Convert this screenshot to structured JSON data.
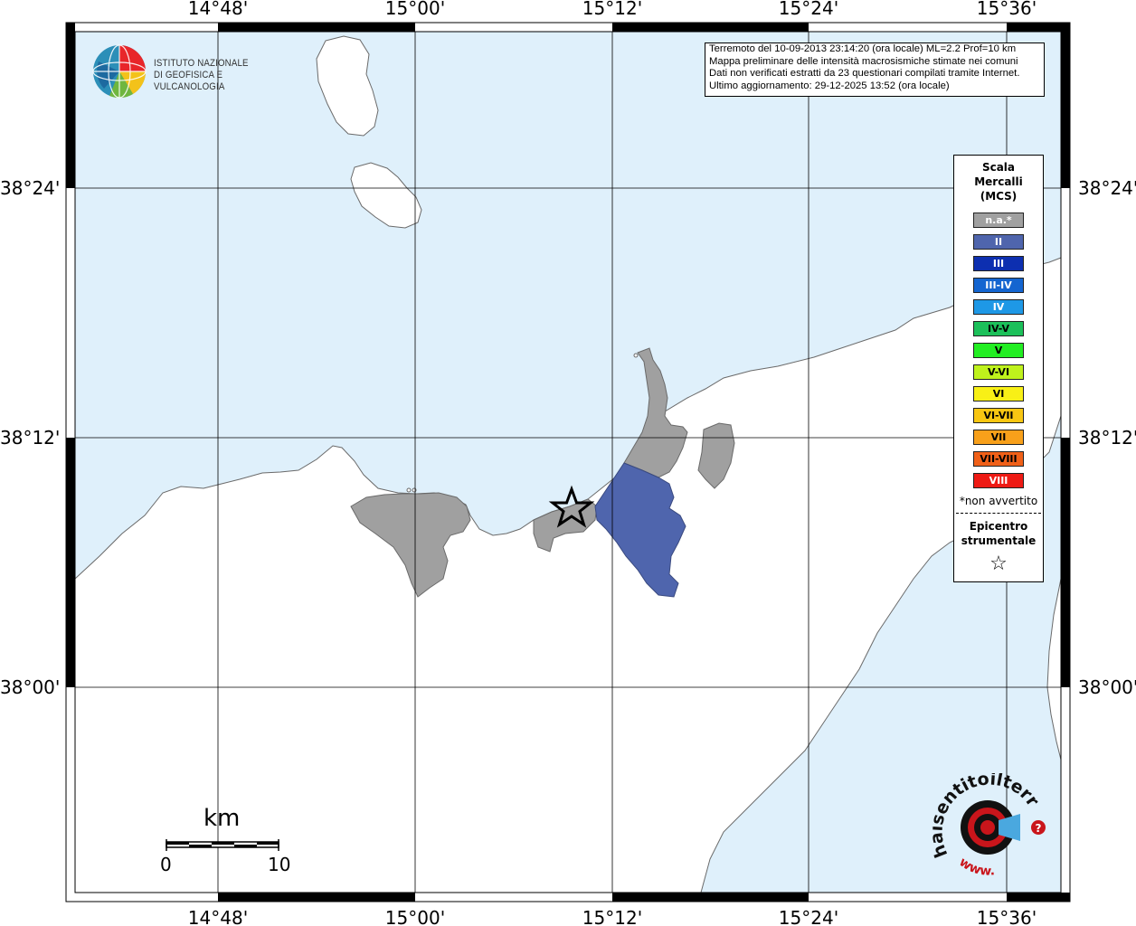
{
  "ticks": {
    "top": [
      "14°48'",
      "15°00'",
      "15°12'",
      "15°24'",
      "15°36'"
    ],
    "bottom": [
      "14°48'",
      "15°00'",
      "15°12'",
      "15°24'",
      "15°36'"
    ],
    "left": [
      "38°24'",
      "38°12'",
      "38°00'"
    ],
    "right": [
      "38°24'",
      "38°12'",
      "38°00'"
    ]
  },
  "info": {
    "line1": "Terremoto del 10-09-2013 23:14:20 (ora locale) ML=2.2 Prof=10 km",
    "line2": "Mappa preliminare delle intensità macrosismiche stimate nei comuni",
    "line3": "Dati non verificati estratti da 23 questionari compilati tramite Internet.",
    "line4": "Ultimo aggiornamento: 29-12-2025 13:52 (ora locale)"
  },
  "logo": {
    "line1": "ISTITUTO NAZIONALE",
    "line2": "DI GEOFISICA E VULCANOLOGIA"
  },
  "legend": {
    "title1": "Scala",
    "title2": "Mercalli",
    "title3": "(MCS)",
    "items": [
      {
        "label": "n.a.*",
        "color": "#a0a0a0",
        "text": "#ffffff"
      },
      {
        "label": "II",
        "color": "#4f65ad",
        "text": "#ffffff"
      },
      {
        "label": "III",
        "color": "#0d2fb0",
        "text": "#ffffff"
      },
      {
        "label": "III-IV",
        "color": "#1465d0",
        "text": "#ffffff"
      },
      {
        "label": "IV",
        "color": "#1e98e6",
        "text": "#ffffff"
      },
      {
        "label": "IV-V",
        "color": "#1cc05a",
        "text": "#000000"
      },
      {
        "label": "V",
        "color": "#22ee22",
        "text": "#000000"
      },
      {
        "label": "V-VI",
        "color": "#bff21c",
        "text": "#000000"
      },
      {
        "label": "VI",
        "color": "#f8f016",
        "text": "#000000"
      },
      {
        "label": "VI-VII",
        "color": "#f8c612",
        "text": "#000000"
      },
      {
        "label": "VII",
        "color": "#f8a01a",
        "text": "#000000"
      },
      {
        "label": "VII-VIII",
        "color": "#f06018",
        "text": "#000000"
      },
      {
        "label": "VIII",
        "color": "#ee1a14",
        "text": "#ffffff"
      }
    ],
    "note": "*non avvertito",
    "epi1": "Epicentro",
    "epi2": "strumentale",
    "star": "☆"
  },
  "scale": {
    "unit": "km",
    "label_min": "0",
    "label_max": "10"
  },
  "hs_logo": {
    "text": "haisentitoilterremoto.it",
    "www": "www."
  },
  "colors": {
    "sea": "#dff0fb",
    "land": "#ffffff",
    "na": "#a0a0a0",
    "intensity_II": "#4f65ad"
  }
}
